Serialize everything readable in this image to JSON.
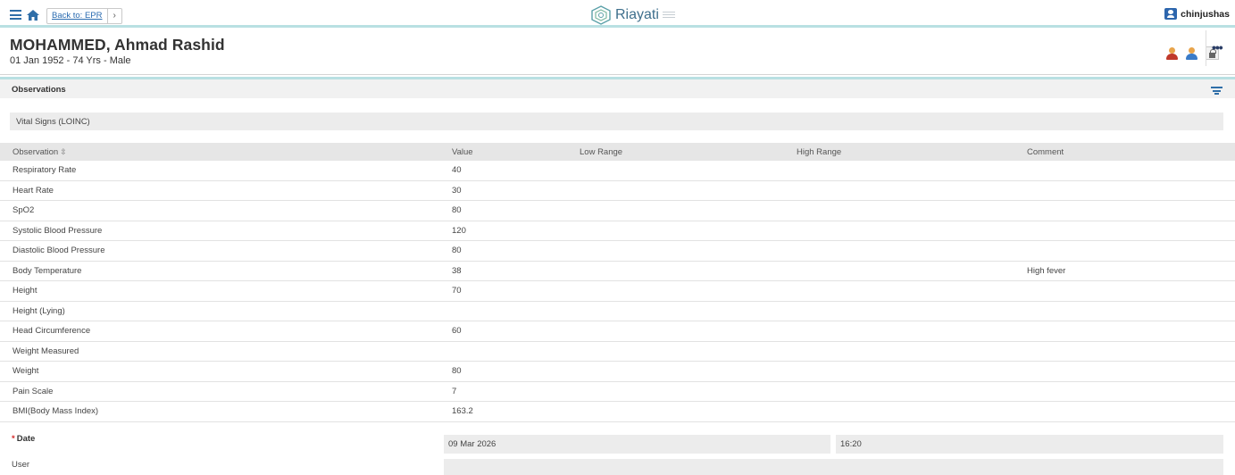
{
  "topbar": {
    "back_label": "Back to: EPR",
    "next_icon": "chevron-right-icon",
    "brand": "Riayati",
    "username": "chinjushas"
  },
  "patient": {
    "name": "MOHAMMED, Ahmad Rashid",
    "demographics": "01 Jan 1952 - 74 Yrs - Male"
  },
  "section": {
    "title": "Observations",
    "group_label": "Vital Signs (LOINC)"
  },
  "table": {
    "headers": {
      "observation": "Observation",
      "value": "Value",
      "low": "Low Range",
      "high": "High Range",
      "comment": "Comment"
    },
    "rows": [
      {
        "observation": "Respiratory Rate",
        "value": "40",
        "low": "",
        "high": "",
        "comment": ""
      },
      {
        "observation": "Heart Rate",
        "value": "30",
        "low": "",
        "high": "",
        "comment": ""
      },
      {
        "observation": "SpO2",
        "value": "80",
        "low": "",
        "high": "",
        "comment": ""
      },
      {
        "observation": "Systolic Blood Pressure",
        "value": "120",
        "low": "",
        "high": "",
        "comment": ""
      },
      {
        "observation": "Diastolic Blood Pressure",
        "value": "80",
        "low": "",
        "high": "",
        "comment": ""
      },
      {
        "observation": "Body Temperature",
        "value": "38",
        "low": "",
        "high": "",
        "comment": "High fever"
      },
      {
        "observation": "Height",
        "value": "70",
        "low": "",
        "high": "",
        "comment": ""
      },
      {
        "observation": "Height (Lying)",
        "value": "",
        "low": "",
        "high": "",
        "comment": ""
      },
      {
        "observation": "Head Circumference",
        "value": "60",
        "low": "",
        "high": "",
        "comment": ""
      },
      {
        "observation": "Weight Measured",
        "value": "",
        "low": "",
        "high": "",
        "comment": ""
      },
      {
        "observation": "Weight",
        "value": "80",
        "low": "",
        "high": "",
        "comment": ""
      },
      {
        "observation": "Pain Scale",
        "value": "7",
        "low": "",
        "high": "",
        "comment": ""
      },
      {
        "observation": "BMI(Body Mass Index)",
        "value": "163.2",
        "low": "",
        "high": "",
        "comment": ""
      }
    ]
  },
  "form": {
    "required_mark": "*",
    "date_label": "Date",
    "date_value": "09 Mar 2026",
    "time_value": "16:20",
    "user_label": "User",
    "user_value": ""
  },
  "colors": {
    "accent": "#2f6ea8",
    "divider": "#b9e0e2",
    "required": "#d62b2b"
  }
}
